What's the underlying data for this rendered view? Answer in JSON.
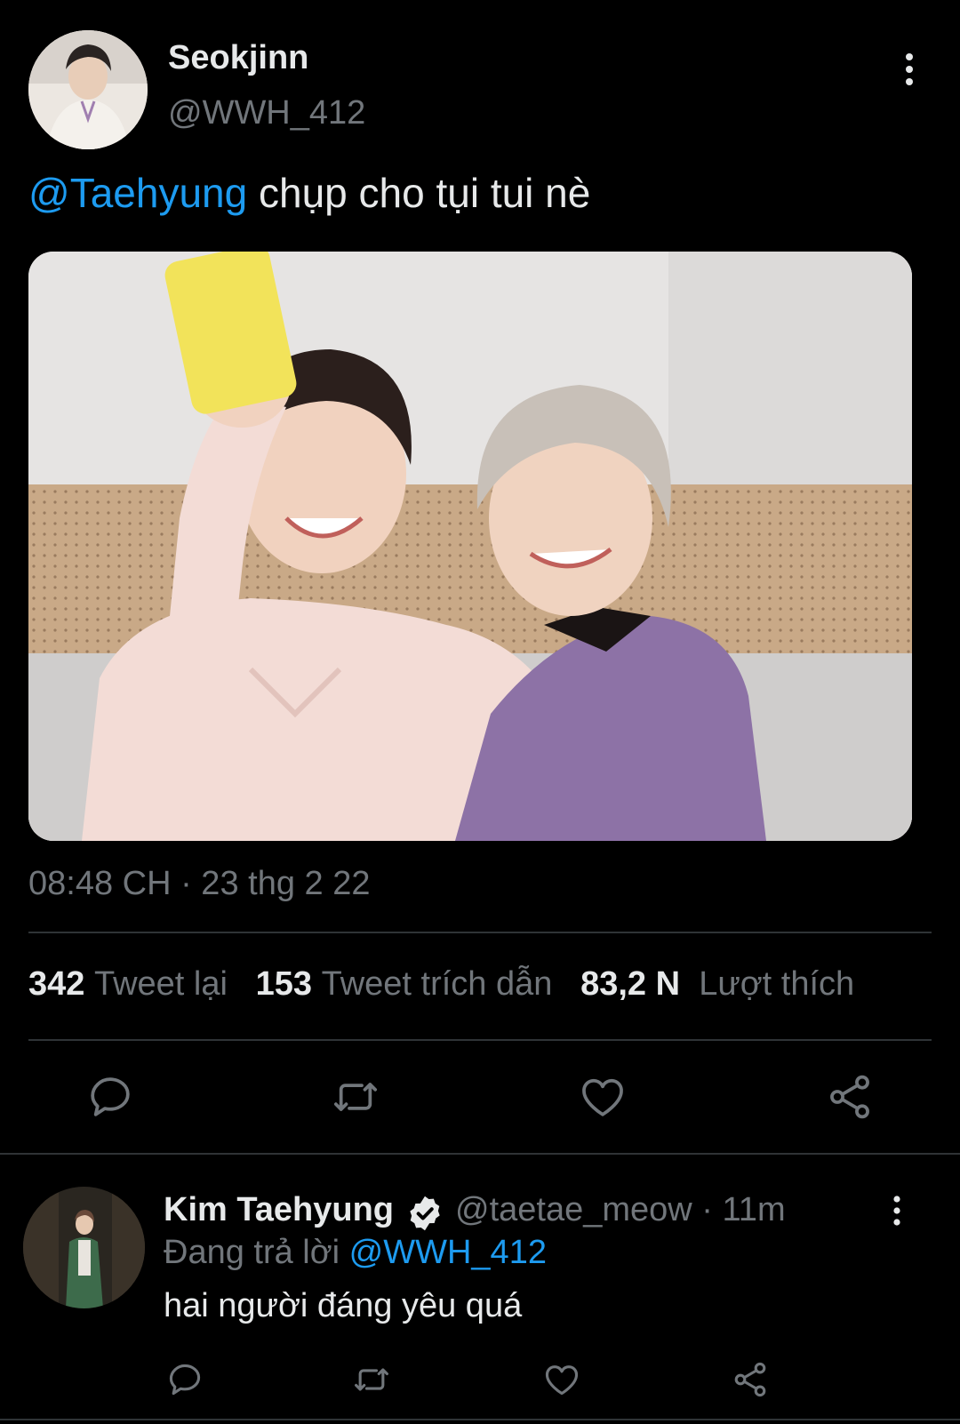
{
  "tweet": {
    "author_name": "Seokjinn",
    "author_handle": "@WWH_412",
    "text_mention": "@Taehyung",
    "text_body": " chụp cho tụi tui nè",
    "timestamp": "08:48 CH · 23 thg 2 22",
    "stats": {
      "retweets_count": "342",
      "retweets_label": "Tweet lại",
      "quotes_count": "153",
      "quotes_label": "Tweet trích dẫn",
      "likes_count": "83,2 N",
      "likes_label": "Lượt thích"
    },
    "icons": {
      "more": "more-vertical-icon",
      "reply": "reply-icon",
      "retweet": "retweet-icon",
      "like": "heart-icon",
      "share": "share-icon"
    }
  },
  "reply": {
    "author_name": "Kim Taehyung",
    "author_handle_time": "@taetae_meow · 11m",
    "replying_prefix": "Đang trả lời ",
    "replying_to": "@WWH_412",
    "text": "hai người đáng yêu quá",
    "verified_icon": "verified-badge-icon"
  },
  "colors": {
    "background": "#000000",
    "text_primary": "#e7e9ea",
    "text_secondary": "#71767b",
    "accent": "#1d9bf0",
    "divider": "#2f3336"
  }
}
